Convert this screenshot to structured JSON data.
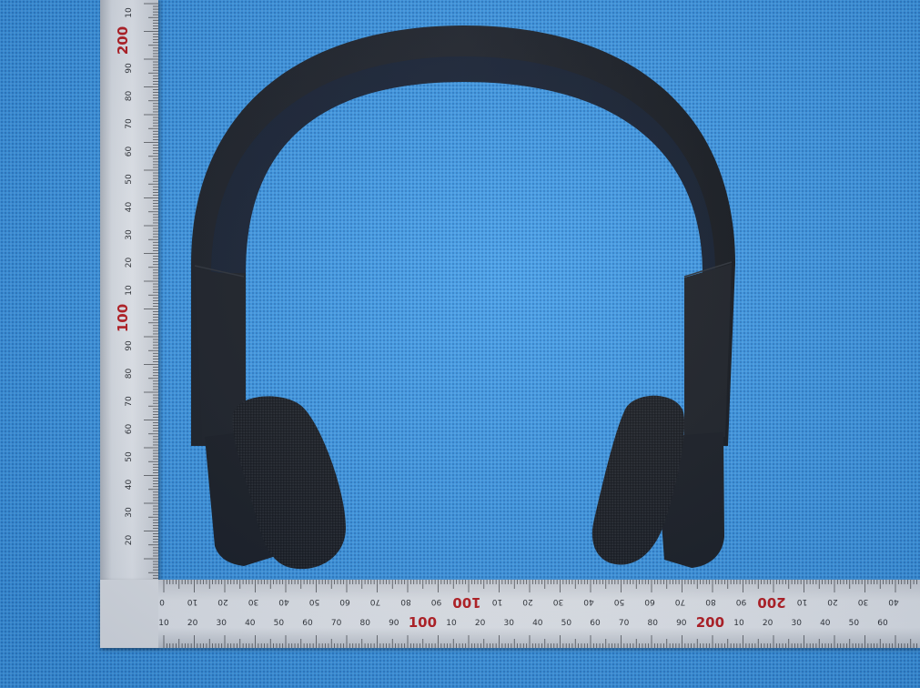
{
  "scene": {
    "subject": "headphones-icon",
    "background_color": "#3f9be6",
    "headphone_color": "#17191d",
    "ruler_color": "#eeeff0",
    "ruler_major_color": "#c01c1c"
  },
  "ruler_vertical": {
    "labels_major": [
      "200",
      "100"
    ],
    "labels_minor": [
      "10",
      "90",
      "80",
      "70",
      "60",
      "50",
      "40",
      "30",
      "20",
      "10",
      "90",
      "80",
      "70",
      "60",
      "50",
      "40",
      "30",
      "20"
    ]
  },
  "ruler_horizontal": {
    "top_row": [
      "0",
      "10",
      "20",
      "30",
      "40",
      "50",
      "60",
      "70",
      "80",
      "90",
      "100",
      "10",
      "20",
      "30",
      "40",
      "50",
      "60",
      "70",
      "80",
      "90",
      "200",
      "10",
      "20",
      "30",
      "40"
    ],
    "bottom_row": [
      "10",
      "20",
      "30",
      "40",
      "50",
      "60",
      "70",
      "80",
      "90",
      "100",
      "10",
      "20",
      "30",
      "40",
      "50",
      "60",
      "70",
      "80",
      "90",
      "200",
      "10",
      "20",
      "30",
      "40",
      "50",
      "60"
    ]
  }
}
